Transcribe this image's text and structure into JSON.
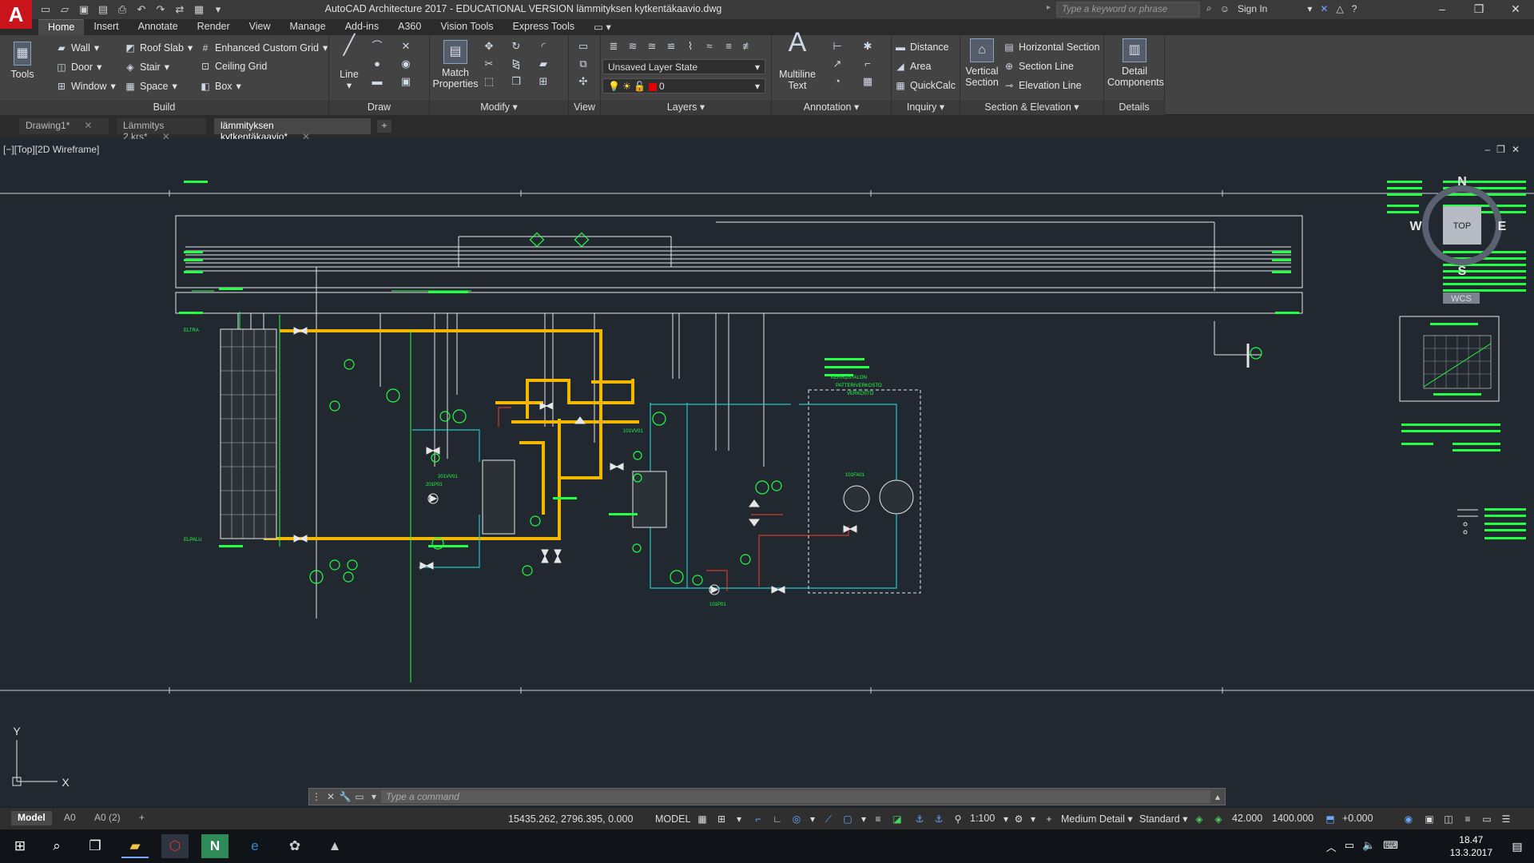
{
  "app": {
    "logo": "A",
    "title": "AutoCAD Architecture 2017 - EDUCATIONAL VERSION    lämmityksen kytkentäkaavio.dwg"
  },
  "search": {
    "placeholder": "Type a keyword or phrase"
  },
  "user": {
    "sign_in": "Sign In"
  },
  "ribbon_tabs": [
    "Home",
    "Insert",
    "Annotate",
    "Render",
    "View",
    "Manage",
    "Add-ins",
    "A360",
    "Vision Tools",
    "Express Tools"
  ],
  "build": {
    "tools": "Tools",
    "wall": "Wall",
    "door": "Door",
    "window": "Window",
    "roof_slab": "Roof Slab",
    "stair": "Stair",
    "space": "Space",
    "enhanced_grid": "Enhanced Custom Grid",
    "ceiling_grid": "Ceiling Grid",
    "box": "Box",
    "title": "Build"
  },
  "draw": {
    "line": "Line",
    "title": "Draw"
  },
  "modify": {
    "match_line1": "Match",
    "match_line2": "Properties",
    "title": "Modify"
  },
  "view_panel": {
    "title": "View"
  },
  "layers": {
    "layer_state": "Unsaved Layer State",
    "current_layer": "0",
    "title": "Layers"
  },
  "annotation": {
    "mtext_line1": "Multiline",
    "mtext_line2": "Text",
    "title": "Annotation"
  },
  "inquiry": {
    "distance": "Distance",
    "area": "Area",
    "quickcalc": "QuickCalc",
    "title": "Inquiry"
  },
  "section": {
    "vertical_line1": "Vertical",
    "vertical_line2": "Section",
    "horizontal": "Horizontal Section",
    "section_line": "Section Line",
    "elevation_line": "Elevation Line",
    "title": "Section & Elevation"
  },
  "details": {
    "dc_line1": "Detail",
    "dc_line2": "Components",
    "title": "Details"
  },
  "doc_tabs": [
    "Drawing1*",
    "Lämmitys 2.krs*",
    "lämmityksen kytkentäkaavio*"
  ],
  "viewport": {
    "label": "[−][Top][2D Wireframe]",
    "compass": {
      "n": "N",
      "s": "S",
      "e": "E",
      "w": "W",
      "top": "TOP",
      "wcs": "WCS"
    }
  },
  "diagram": {
    "texts": [
      "ELTRA",
      "ELPALU",
      "PATTERIVERKOSTO",
      "KERROSTALON",
      "VERKOSTO",
      "201P01",
      "101P01",
      "101VV01",
      "201VV01",
      "101FA01"
    ]
  },
  "command": {
    "placeholder": "Type  a  command"
  },
  "layout_tabs": [
    "Model",
    "A0",
    "A0 (2)"
  ],
  "status": {
    "coords": "15435.262, 2796.395, 0.000",
    "space": "MODEL",
    "scale": "1:100",
    "detail": "Medium Detail",
    "style": "Standard",
    "cut_plane": "42.000",
    "elevation": "1400.000",
    "offset": "+0.000"
  },
  "clock": {
    "time": "18.47",
    "date": "13.3.2017"
  },
  "colors": {
    "pipe": "#f5b800",
    "green": "#22ff44",
    "cyan": "#20c8c8",
    "red": "#d33a2c",
    "white": "#e6e6e6"
  }
}
